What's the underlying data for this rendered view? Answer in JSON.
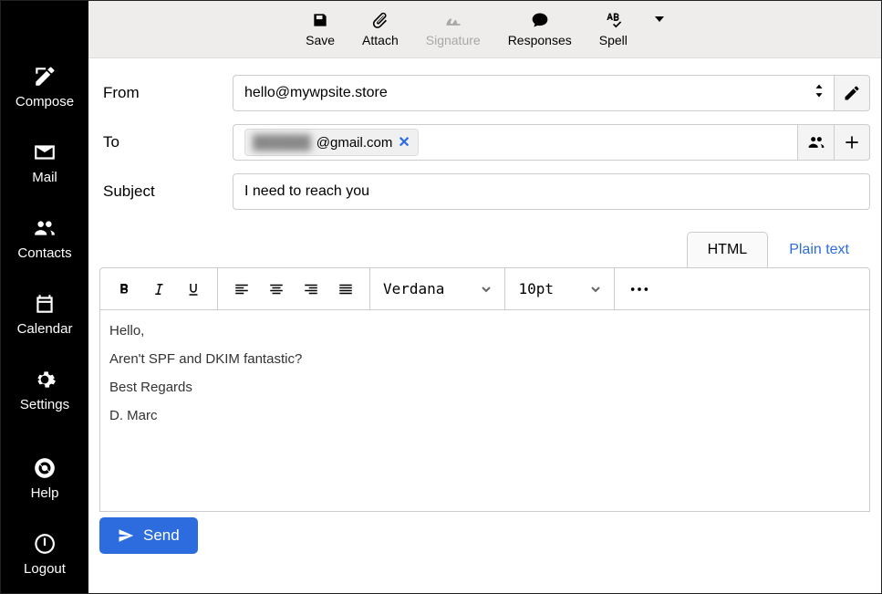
{
  "sidebar": {
    "items": [
      {
        "label": "Compose"
      },
      {
        "label": "Mail"
      },
      {
        "label": "Contacts"
      },
      {
        "label": "Calendar"
      },
      {
        "label": "Settings"
      }
    ],
    "bottom": [
      {
        "label": "Help"
      },
      {
        "label": "Logout"
      }
    ]
  },
  "toolbar": {
    "save": "Save",
    "attach": "Attach",
    "signature": "Signature",
    "responses": "Responses",
    "spell": "Spell"
  },
  "form": {
    "from_label": "From",
    "from_value": "hello@mywpsite.store",
    "to_label": "To",
    "to_chip_blur": "██████",
    "to_chip_visible": "@gmail.com",
    "subject_label": "Subject",
    "subject_value": "I need to reach you"
  },
  "editor": {
    "tabs": {
      "html": "HTML",
      "plain": "Plain text"
    },
    "font_family": "Verdana",
    "font_size": "10pt",
    "body": [
      "Hello,",
      "Aren't SPF and DKIM fantastic?",
      "Best Regards",
      "D. Marc"
    ]
  },
  "send_label": "Send"
}
